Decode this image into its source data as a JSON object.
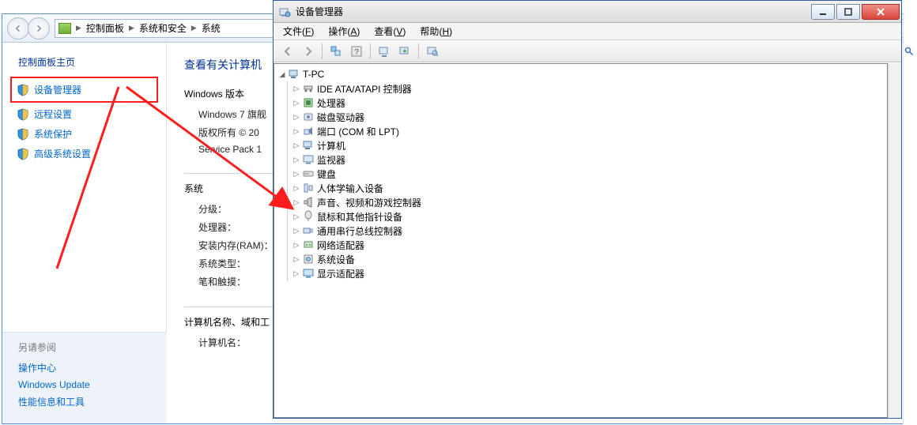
{
  "control_panel": {
    "breadcrumb": [
      "控制面板",
      "系统和安全",
      "系统"
    ],
    "sidebar": {
      "header": "控制面板主页",
      "items": [
        {
          "label": "设备管理器",
          "highlighted": true
        },
        {
          "label": "远程设置"
        },
        {
          "label": "系统保护"
        },
        {
          "label": "高级系统设置"
        }
      ],
      "refs_header": "另请参阅",
      "refs": [
        "操作中心",
        "Windows Update",
        "性能信息和工具"
      ]
    },
    "main": {
      "title": "查看有关计算机",
      "win_version_label": "Windows 版本",
      "win_version_lines": [
        "Windows 7 旗舰",
        "版权所有 © 20",
        "Service Pack 1"
      ],
      "system_label": "系统",
      "system_rows": [
        "分级：",
        "处理器：",
        "安装内存(RAM)：",
        "系统类型：",
        "笔和触摸："
      ],
      "name_label": "计算机名称、域和工",
      "name_rows": [
        "计算机名："
      ]
    }
  },
  "device_manager": {
    "title": "设备管理器",
    "menu": [
      {
        "label": "文件",
        "key": "F"
      },
      {
        "label": "操作",
        "key": "A"
      },
      {
        "label": "查看",
        "key": "V"
      },
      {
        "label": "帮助",
        "key": "H"
      }
    ],
    "root": "T-PC",
    "nodes": [
      "IDE ATA/ATAPI 控制器",
      "处理器",
      "磁盘驱动器",
      "端口 (COM 和 LPT)",
      "计算机",
      "监视器",
      "键盘",
      "人体学输入设备",
      "声音、视频和游戏控制器",
      "鼠标和其他指针设备",
      "通用串行总线控制器",
      "网络适配器",
      "系统设备",
      "显示适配器"
    ]
  },
  "colors": {
    "accent": "#0066cc",
    "highlight": "#ff1e1e"
  }
}
